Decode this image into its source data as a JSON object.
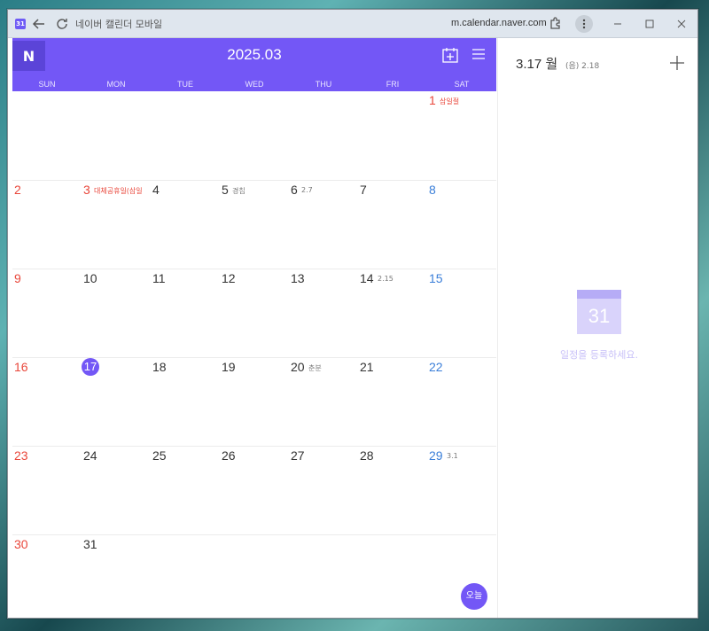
{
  "browser": {
    "app_icon": "31",
    "title": "네이버 캘린더 모바일",
    "url": "m.calendar.naver.com"
  },
  "header": {
    "logo": "N",
    "month_title": "2025.03",
    "accent": "#7357f6"
  },
  "days_of_week": [
    "SUN",
    "MON",
    "TUE",
    "WED",
    "THU",
    "FRI",
    "SAT"
  ],
  "weeks": [
    [
      {
        "num": "",
        "note": ""
      },
      {
        "num": "",
        "note": ""
      },
      {
        "num": "",
        "note": ""
      },
      {
        "num": "",
        "note": ""
      },
      {
        "num": "",
        "note": ""
      },
      {
        "num": "",
        "note": ""
      },
      {
        "num": "1",
        "note": "삼일절",
        "holiday": true
      }
    ],
    [
      {
        "num": "2",
        "note": ""
      },
      {
        "num": "3",
        "note": "대체공휴일(삼일",
        "holiday": true
      },
      {
        "num": "4",
        "note": ""
      },
      {
        "num": "5",
        "note": "경칩"
      },
      {
        "num": "6",
        "note": "2.7"
      },
      {
        "num": "7",
        "note": ""
      },
      {
        "num": "8",
        "note": ""
      }
    ],
    [
      {
        "num": "9",
        "note": ""
      },
      {
        "num": "10",
        "note": ""
      },
      {
        "num": "11",
        "note": ""
      },
      {
        "num": "12",
        "note": ""
      },
      {
        "num": "13",
        "note": ""
      },
      {
        "num": "14",
        "note": "2.15"
      },
      {
        "num": "15",
        "note": ""
      }
    ],
    [
      {
        "num": "16",
        "note": ""
      },
      {
        "num": "17",
        "note": "",
        "today": true
      },
      {
        "num": "18",
        "note": ""
      },
      {
        "num": "19",
        "note": ""
      },
      {
        "num": "20",
        "note": "춘분"
      },
      {
        "num": "21",
        "note": ""
      },
      {
        "num": "22",
        "note": ""
      }
    ],
    [
      {
        "num": "23",
        "note": ""
      },
      {
        "num": "24",
        "note": ""
      },
      {
        "num": "25",
        "note": ""
      },
      {
        "num": "26",
        "note": ""
      },
      {
        "num": "27",
        "note": ""
      },
      {
        "num": "28",
        "note": ""
      },
      {
        "num": "29",
        "note": "3.1"
      }
    ],
    [
      {
        "num": "30",
        "note": ""
      },
      {
        "num": "31",
        "note": ""
      },
      {
        "num": "",
        "note": ""
      },
      {
        "num": "",
        "note": ""
      },
      {
        "num": "",
        "note": ""
      },
      {
        "num": "",
        "note": ""
      },
      {
        "num": "",
        "note": ""
      }
    ]
  ],
  "today_button": "오늘",
  "side": {
    "date": "3.17 월",
    "sub": "(음) 2.18",
    "empty_icon_text": "31",
    "empty_text": "일정을 등록하세요."
  }
}
